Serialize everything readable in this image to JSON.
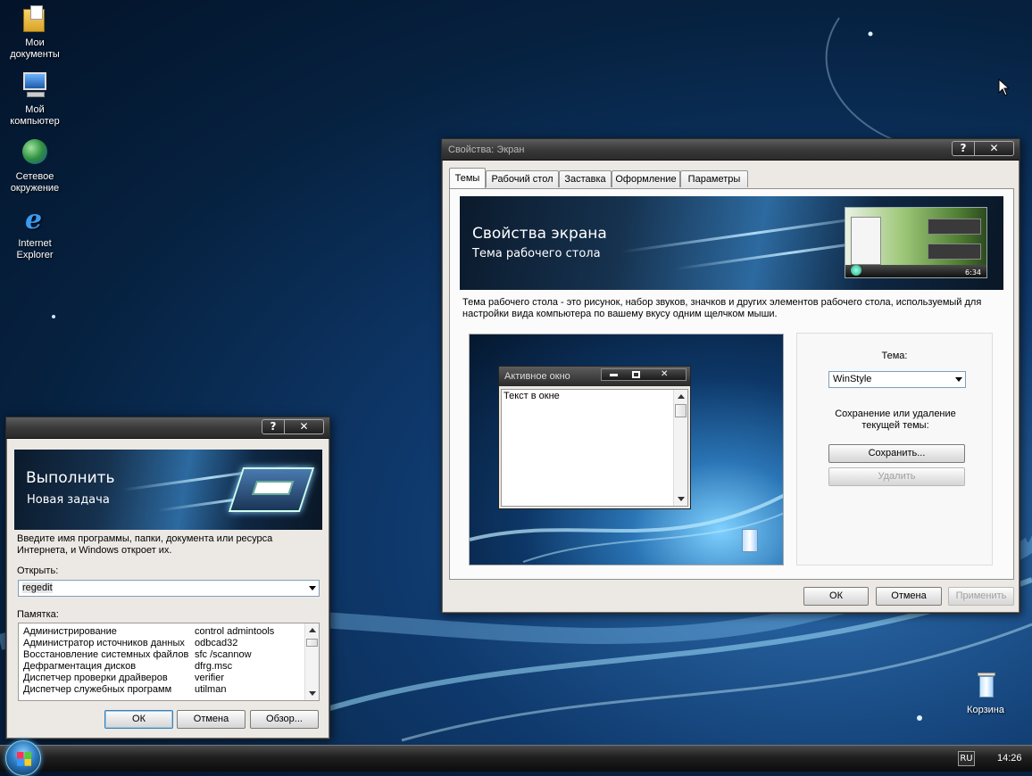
{
  "desktop": {
    "icons": [
      {
        "label_line1": "Мои",
        "label_line2": "документы",
        "icon": "documents-icon"
      },
      {
        "label_line1": "Мой",
        "label_line2": "компьютер",
        "icon": "computer-icon"
      },
      {
        "label_line1": "Сетевое",
        "label_line2": "окружение",
        "icon": "network-icon"
      },
      {
        "label_line1": "Internet",
        "label_line2": "Explorer",
        "icon": "internet-explorer-icon"
      }
    ],
    "recycle_bin_label": "Корзина"
  },
  "display_properties": {
    "title": "Свойства: Экран",
    "help_label": "?",
    "close_label": "✕",
    "tabs": [
      "Темы",
      "Рабочий стол",
      "Заставка",
      "Оформление",
      "Параметры"
    ],
    "active_tab": "Темы",
    "banner_title": "Свойства экрана",
    "banner_subtitle": "Тема рабочего стола",
    "banner_clock": "6:34",
    "description": "Тема рабочего стола - это рисунок, набор звуков, значков и других элементов рабочего стола, используемый для настройки вида компьютера по вашему вкусу одним щелчком мыши.",
    "preview": {
      "window_title": "Активное окно",
      "window_text": "Текст в окне"
    },
    "theme_label": "Тема:",
    "theme_value": "WinStyle",
    "save_delete_label": "Сохранение или удаление текущей темы:",
    "save_button": "Сохранить...",
    "delete_button": "Удалить",
    "ok_button": "ОК",
    "cancel_button": "Отмена",
    "apply_button": "Применить"
  },
  "run_dialog": {
    "help_label": "?",
    "close_label": "✕",
    "banner_title": "Выполнить",
    "banner_subtitle": "Новая задача",
    "description": "Введите имя программы, папки, документа или ресурса Интернета, и Windows откроет их.",
    "open_label": "Открыть:",
    "open_value": "regedit",
    "memo_label": "Памятка:",
    "memo_items": [
      {
        "name": "Администрирование",
        "cmd": "control admintools"
      },
      {
        "name": "Администратор источников данных",
        "cmd": "odbcad32"
      },
      {
        "name": "Восстановление системных файлов",
        "cmd": "sfc /scannow"
      },
      {
        "name": "Дефрагментация дисков",
        "cmd": "dfrg.msc"
      },
      {
        "name": "Диспетчер проверки драйверов",
        "cmd": "verifier"
      },
      {
        "name": "Диспетчер служебных программ",
        "cmd": "utilman"
      }
    ],
    "ok_button": "ОК",
    "cancel_button": "Отмена",
    "browse_button": "Обзор..."
  },
  "taskbar": {
    "language": "RU",
    "clock": "14:26"
  }
}
